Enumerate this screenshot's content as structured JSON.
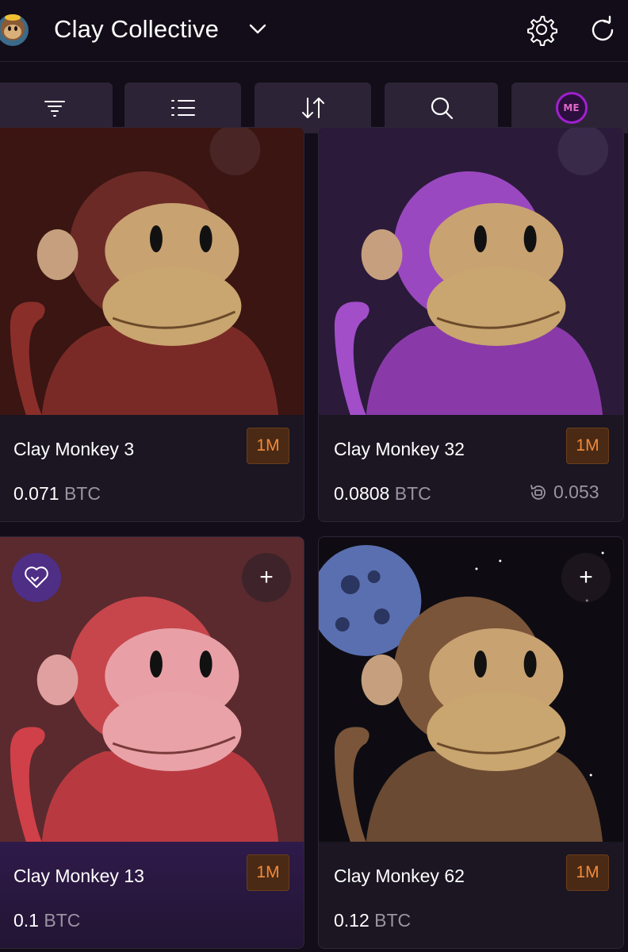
{
  "header": {
    "collection_title": "Clay Collective",
    "logo_icon": "monkey-logo-icon",
    "chevron_icon": "chevron-down-icon",
    "settings_icon": "gear-icon",
    "refresh_icon": "refresh-icon"
  },
  "toolbar": {
    "buttons": [
      {
        "icon": "filter-icon"
      },
      {
        "icon": "list-view-icon"
      },
      {
        "icon": "sort-icon"
      },
      {
        "icon": "search-icon"
      },
      {
        "icon": "magic-eden-icon",
        "label": "ME"
      }
    ]
  },
  "cards": [
    {
      "name": "Clay Monkey 3",
      "badge": "1M",
      "price": "0.071",
      "currency": "BTC",
      "color": "#6b2a26",
      "bg": "#3a1512"
    },
    {
      "name": "Clay Monkey 32",
      "badge": "1M",
      "price": "0.0808",
      "currency": "BTC",
      "last_sale": "0.053",
      "color": "#8a3aa8",
      "bg": "#2b1a3a"
    },
    {
      "name": "Clay Monkey 13",
      "badge": "1M",
      "price": "0.1",
      "currency": "BTC",
      "add": "+",
      "color": "#c6464c",
      "bg": "#5a2a2e"
    },
    {
      "name": "Clay Monkey 62",
      "badge": "1M",
      "price": "0.12",
      "currency": "BTC",
      "add": "+",
      "color": "#7a553a",
      "bg": "#0e0c12"
    }
  ],
  "colors": {
    "background": "#120d18",
    "card": "#1b1622",
    "toolbar_button": "#2d2336",
    "badge_text": "#f08a3c",
    "badge_bg": "#4a2a14",
    "listing_badge": "#4f2e86"
  }
}
